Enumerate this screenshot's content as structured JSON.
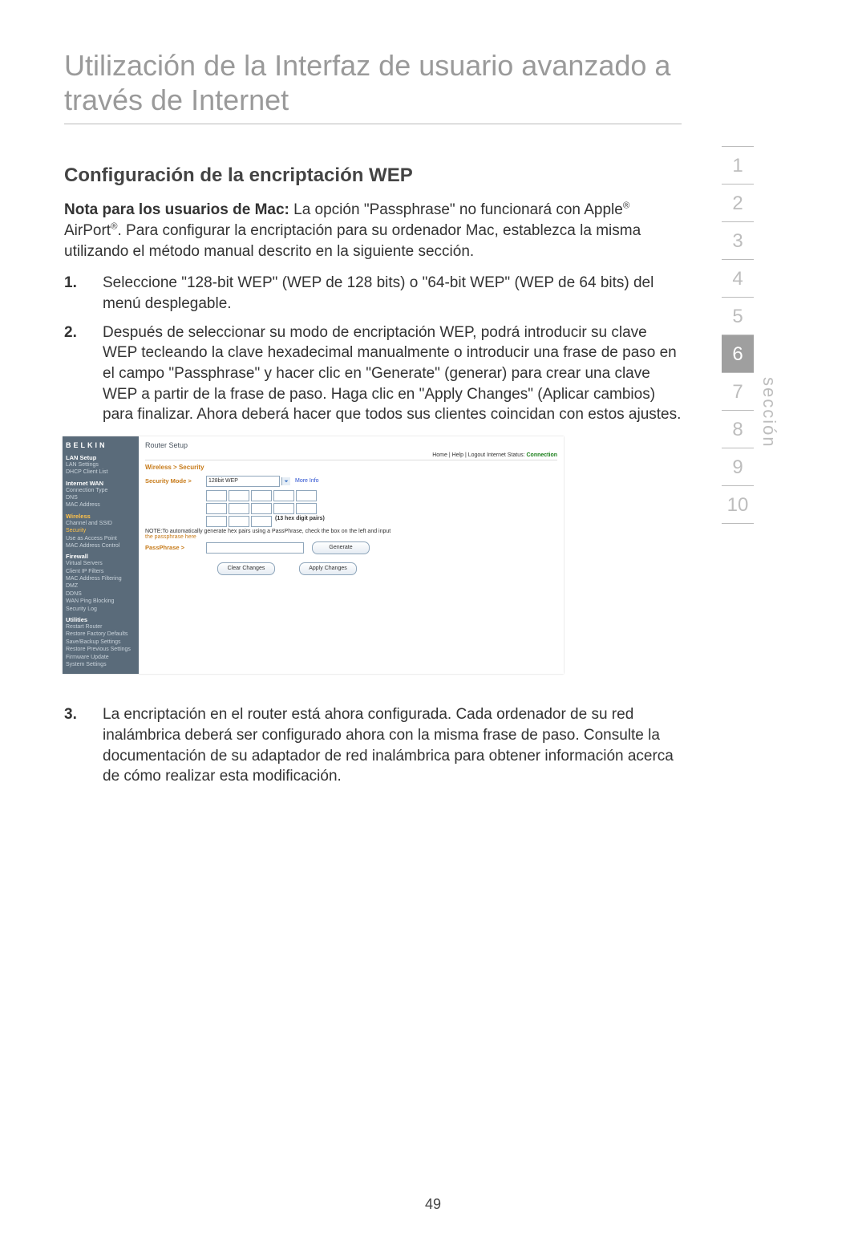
{
  "title": "Utilización de la Interfaz de usuario avanzado a través de Internet",
  "subtitle": "Configuración de la encriptación WEP",
  "mac_note_label": "Nota para los usuarios de Mac:",
  "mac_note_text": " La opción \"Passphrase\" no funcionará con Apple",
  "mac_note_text2": " AirPort",
  "mac_note_text3": ". Para configurar la encriptación para su ordenador Mac, establezca la misma utilizando el método manual descrito en la siguiente sección.",
  "reg_mark": "®",
  "steps": [
    "Seleccione \"128-bit WEP\" (WEP de 128 bits) o \"64-bit WEP\" (WEP de 64 bits) del menú desplegable.",
    "Después de seleccionar su modo de encriptación WEP, podrá introducir su clave WEP tecleando la clave hexadecimal manualmente  o introducir una frase de paso en el campo \"Passphrase\" y hacer clic en \"Generate\" (generar) para crear una clave WEP a partir de la frase de paso. Haga clic en \"Apply Changes\" (Aplicar cambios) para finalizar. Ahora deberá hacer que todos sus clientes coincidan con estos ajustes.",
    "La encriptación en el router está ahora configurada. Cada ordenador de su red inalámbrica deberá ser configurado ahora con la misma frase de paso. Consulte la documentación de su adaptador de red inalámbrica para obtener información acerca de cómo realizar esta modificación."
  ],
  "section_tabs": [
    "1",
    "2",
    "3",
    "4",
    "5",
    "6",
    "7",
    "8",
    "9",
    "10"
  ],
  "active_section": 6,
  "seccion_label": "sección",
  "page_number": "49",
  "router": {
    "brand": "BELKIN",
    "header": "Router Setup",
    "toplinks": "Home | Help | Logout   Internet Status:",
    "connection": "Connection",
    "breadcrumb": "Wireless > Security",
    "security_mode_label": "Security Mode >",
    "security_mode_value": "128bit WEP",
    "more_info": "More Info",
    "hex_note": "(13 hex digit pairs)",
    "note_line1": "NOTE:To automatically generate hex pairs using a PassPhrase, check the box on the left and input",
    "note_line2": "the passphrase here",
    "passphrase_label": "PassPhrase >",
    "btn_generate": "Generate",
    "btn_clear": "Clear Changes",
    "btn_apply": "Apply Changes",
    "sidebar": {
      "groups": [
        {
          "title": "LAN Setup",
          "items": [
            "LAN Settings",
            "DHCP Client List"
          ]
        },
        {
          "title": "Internet WAN",
          "items": [
            "Connection Type",
            "DNS",
            "MAC Address"
          ]
        },
        {
          "title": "Wireless",
          "hl": true,
          "items": [
            "Channel and SSID",
            "Security",
            "Use as Access Point",
            "MAC Address Control"
          ]
        },
        {
          "title": "Firewall",
          "items": [
            "Virtual Servers",
            "Client IP Filters",
            "MAC Address Filtering",
            "DMZ",
            "DDNS",
            "WAN Ping Blocking",
            "Security Log"
          ]
        },
        {
          "title": "Utilities",
          "items": [
            "Restart Router",
            "Restore Factory Defaults",
            "Save/Backup Settings",
            "Restore Previous Settings",
            "Firmware Update",
            "System Settings"
          ]
        }
      ],
      "security_idx": {
        "group": 2,
        "item": 1
      }
    }
  }
}
